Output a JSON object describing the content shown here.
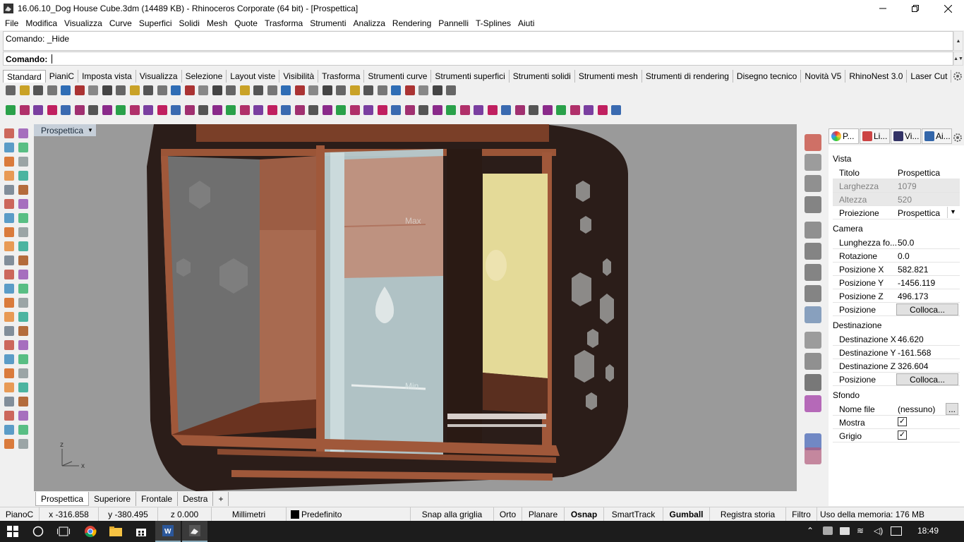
{
  "window": {
    "title": "16.06.10_Dog House Cube.3dm (14489 KB) - Rhinoceros Corporate (64 bit) - [Prospettica]",
    "controls": [
      "minimize",
      "restore",
      "close"
    ]
  },
  "menu": [
    "File",
    "Modifica",
    "Visualizza",
    "Curve",
    "Superfici",
    "Solidi",
    "Mesh",
    "Quote",
    "Trasforma",
    "Strumenti",
    "Analizza",
    "Rendering",
    "Pannelli",
    "T-Splines",
    "Aiuti"
  ],
  "command": {
    "history": "Comando: _Hide",
    "prompt_label": "Comando:",
    "value": ""
  },
  "toolbar_tabs": [
    "Standard",
    "PianiC",
    "Imposta vista",
    "Visualizza",
    "Selezione",
    "Layout viste",
    "Visibilità",
    "Trasforma",
    "Strumenti curve",
    "Strumenti superfici",
    "Strumenti solidi",
    "Strumenti mesh",
    "Strumenti di rendering",
    "Disegno tecnico",
    "Novità V5",
    "RhinoNest 3.0",
    "Laser Cut"
  ],
  "viewport": {
    "title": "Prospettica",
    "scene_labels": {
      "max": "Max",
      "min": "Min"
    },
    "axes": {
      "x": "x",
      "z": "z"
    }
  },
  "viewport_tabs": [
    "Prospettica",
    "Superiore",
    "Frontale",
    "Destra"
  ],
  "properties": {
    "tabs": [
      "P...",
      "Li...",
      "Vi...",
      "Ai..."
    ],
    "sections": {
      "vista": "Vista",
      "camera": "Camera",
      "destinazione": "Destinazione",
      "sfondo": "Sfondo"
    },
    "vista": [
      {
        "k": "Titolo",
        "v": "Prospettica"
      },
      {
        "k": "Larghezza",
        "v": "1079"
      },
      {
        "k": "Altezza",
        "v": "520"
      },
      {
        "k": "Proiezione",
        "v": "Prospettica"
      }
    ],
    "camera": [
      {
        "k": "Lunghezza fo...",
        "v": "50.0"
      },
      {
        "k": "Rotazione",
        "v": "0.0"
      },
      {
        "k": "Posizione X",
        "v": "582.821"
      },
      {
        "k": "Posizione Y",
        "v": "-1456.119"
      },
      {
        "k": "Posizione Z",
        "v": "496.173"
      },
      {
        "k": "Posizione",
        "v": "Colloca..."
      }
    ],
    "destinazione": [
      {
        "k": "Destinazione X",
        "v": "46.620"
      },
      {
        "k": "Destinazione Y",
        "v": "-161.568"
      },
      {
        "k": "Destinazione Z",
        "v": "326.604"
      },
      {
        "k": "Posizione",
        "v": "Colloca..."
      }
    ],
    "sfondo": [
      {
        "k": "Nome file",
        "v": "(nessuno)",
        "btn": "..."
      },
      {
        "k": "Mostra",
        "checked": true
      },
      {
        "k": "Grigio",
        "checked": true
      }
    ]
  },
  "status": {
    "plane": "PianoC",
    "x": "x -316.858",
    "y": "y -380.495",
    "z": "z 0.000",
    "units": "Millimetri",
    "layer": "Predefinito",
    "snap_grid": "Snap alla griglia",
    "orto": "Orto",
    "planare": "Planare",
    "osnap": "Osnap",
    "smarttrack": "SmartTrack",
    "gumball": "Gumball",
    "history": "Registra storia",
    "filtro": "Filtro",
    "memory": "Uso della memoria: 176 MB"
  },
  "taskbar": {
    "clock": "18:49"
  },
  "colors": {
    "viewport_bg": "#9a9a9a",
    "wood": "#a0583a",
    "dark_panel": "#2a1c18",
    "water": "#b9cdd0",
    "yellow_panel": "#e6dc9a"
  }
}
